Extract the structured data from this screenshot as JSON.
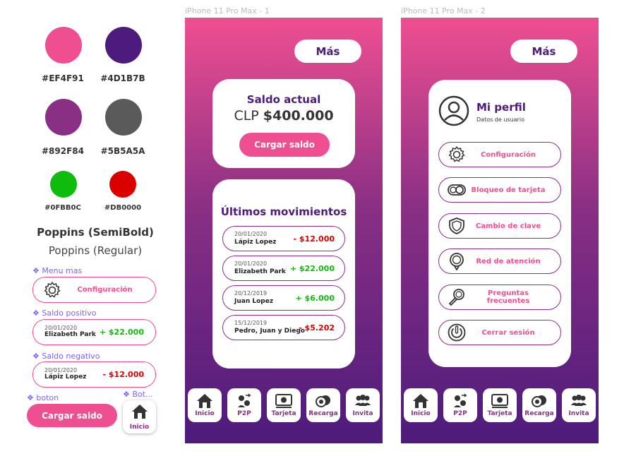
{
  "colors": {
    "pink": "#EF4F91",
    "indigo": "#4D1B7B",
    "purple": "#892F84",
    "gray": "#5B5A5A",
    "green": "#0FBB0C",
    "red": "#DB0000"
  },
  "styleguide": {
    "swatches": [
      {
        "hex": "#EF4F91"
      },
      {
        "hex": "#4D1B7B"
      },
      {
        "hex": "#892F84"
      },
      {
        "hex": "#5B5A5A"
      },
      {
        "hex": "#0FBB0C"
      },
      {
        "hex": "#DB0000"
      }
    ],
    "font_semibold": "Poppins (SemiBold)",
    "font_regular": "Poppins (Regular)",
    "tag_menu": "❖ Menu mas",
    "menu_example_label": "Configuración",
    "tag_positive": "❖ Saldo positivo",
    "positive": {
      "date": "20/01/2020",
      "name": "Elizabeth Park",
      "amount": "+ $22.000"
    },
    "tag_negative": "❖ Saldo negativo",
    "negative": {
      "date": "20/01/2020",
      "name": "Lápiz Lopez",
      "amount": "- $12.000"
    },
    "tag_boton": "❖ boton",
    "tag_bot": "❖ Bot...",
    "cargar_label": "Cargar saldo",
    "inicio_label": "Inicio"
  },
  "phone1": {
    "frame_title": "iPhone 11 Pro Max - 1",
    "mas": "Más",
    "saldo_title": "Saldo actual",
    "saldo_prefix": "CLP ",
    "saldo_value": "$400.000",
    "cargar": "Cargar saldo",
    "movimientos_title": "Últimos movimientos",
    "movimientos": [
      {
        "date": "20/01/2020",
        "name": "Lápiz Lopez",
        "amount": "- $12.000"
      },
      {
        "date": "20/01/2020",
        "name": "Elizabeth Park",
        "amount": "+ $22.000"
      },
      {
        "date": "20/12/2019",
        "name": "Juan Lopez",
        "amount": "+ $6.000"
      },
      {
        "date": "15/12/2019",
        "name": "Pedro, Juan y Diego",
        "amount": "- $5.202"
      }
    ]
  },
  "phone2": {
    "frame_title": "iPhone 11 Pro Max - 2",
    "mas": "Más",
    "perfil_title": "Mi perfil",
    "perfil_sub": "Datos de usuario",
    "menu": [
      {
        "label": "Configuración",
        "icon": "gear-icon"
      },
      {
        "label": "Bloqueo de tarjeta",
        "icon": "toggle-icon"
      },
      {
        "label": "Cambio de clave",
        "icon": "shield-icon"
      },
      {
        "label": "Red de atención",
        "icon": "location-pin-icon"
      },
      {
        "label": "Preguntas frecuentes",
        "icon": "magnifier-icon"
      },
      {
        "label": "Cerrar sesión",
        "icon": "power-icon"
      }
    ]
  },
  "nav": [
    {
      "label": "Inicio",
      "icon": "home-icon"
    },
    {
      "label": "P2P",
      "icon": "p2p-icon"
    },
    {
      "label": "Tarjeta",
      "icon": "card-icon"
    },
    {
      "label": "Recarga",
      "icon": "coins-icon"
    },
    {
      "label": "Invita",
      "icon": "people-icon"
    }
  ]
}
